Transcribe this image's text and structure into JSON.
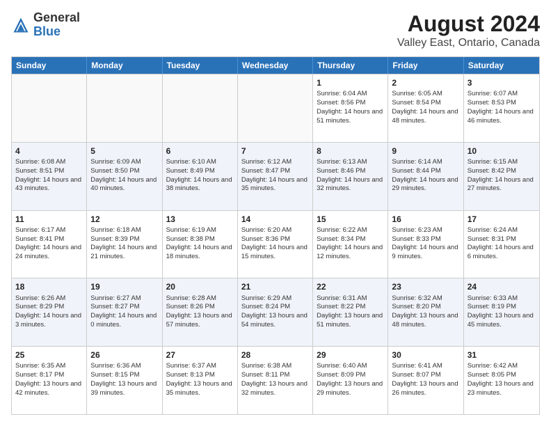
{
  "logo": {
    "general": "General",
    "blue": "Blue"
  },
  "header": {
    "monthYear": "August 2024",
    "location": "Valley East, Ontario, Canada"
  },
  "calendar": {
    "weekdays": [
      "Sunday",
      "Monday",
      "Tuesday",
      "Wednesday",
      "Thursday",
      "Friday",
      "Saturday"
    ],
    "rows": [
      [
        {
          "day": "",
          "info": ""
        },
        {
          "day": "",
          "info": ""
        },
        {
          "day": "",
          "info": ""
        },
        {
          "day": "",
          "info": ""
        },
        {
          "day": "1",
          "info": "Sunrise: 6:04 AM\nSunset: 8:56 PM\nDaylight: 14 hours and 51 minutes."
        },
        {
          "day": "2",
          "info": "Sunrise: 6:05 AM\nSunset: 8:54 PM\nDaylight: 14 hours and 48 minutes."
        },
        {
          "day": "3",
          "info": "Sunrise: 6:07 AM\nSunset: 8:53 PM\nDaylight: 14 hours and 46 minutes."
        }
      ],
      [
        {
          "day": "4",
          "info": "Sunrise: 6:08 AM\nSunset: 8:51 PM\nDaylight: 14 hours and 43 minutes."
        },
        {
          "day": "5",
          "info": "Sunrise: 6:09 AM\nSunset: 8:50 PM\nDaylight: 14 hours and 40 minutes."
        },
        {
          "day": "6",
          "info": "Sunrise: 6:10 AM\nSunset: 8:49 PM\nDaylight: 14 hours and 38 minutes."
        },
        {
          "day": "7",
          "info": "Sunrise: 6:12 AM\nSunset: 8:47 PM\nDaylight: 14 hours and 35 minutes."
        },
        {
          "day": "8",
          "info": "Sunrise: 6:13 AM\nSunset: 8:46 PM\nDaylight: 14 hours and 32 minutes."
        },
        {
          "day": "9",
          "info": "Sunrise: 6:14 AM\nSunset: 8:44 PM\nDaylight: 14 hours and 29 minutes."
        },
        {
          "day": "10",
          "info": "Sunrise: 6:15 AM\nSunset: 8:42 PM\nDaylight: 14 hours and 27 minutes."
        }
      ],
      [
        {
          "day": "11",
          "info": "Sunrise: 6:17 AM\nSunset: 8:41 PM\nDaylight: 14 hours and 24 minutes."
        },
        {
          "day": "12",
          "info": "Sunrise: 6:18 AM\nSunset: 8:39 PM\nDaylight: 14 hours and 21 minutes."
        },
        {
          "day": "13",
          "info": "Sunrise: 6:19 AM\nSunset: 8:38 PM\nDaylight: 14 hours and 18 minutes."
        },
        {
          "day": "14",
          "info": "Sunrise: 6:20 AM\nSunset: 8:36 PM\nDaylight: 14 hours and 15 minutes."
        },
        {
          "day": "15",
          "info": "Sunrise: 6:22 AM\nSunset: 8:34 PM\nDaylight: 14 hours and 12 minutes."
        },
        {
          "day": "16",
          "info": "Sunrise: 6:23 AM\nSunset: 8:33 PM\nDaylight: 14 hours and 9 minutes."
        },
        {
          "day": "17",
          "info": "Sunrise: 6:24 AM\nSunset: 8:31 PM\nDaylight: 14 hours and 6 minutes."
        }
      ],
      [
        {
          "day": "18",
          "info": "Sunrise: 6:26 AM\nSunset: 8:29 PM\nDaylight: 14 hours and 3 minutes."
        },
        {
          "day": "19",
          "info": "Sunrise: 6:27 AM\nSunset: 8:27 PM\nDaylight: 14 hours and 0 minutes."
        },
        {
          "day": "20",
          "info": "Sunrise: 6:28 AM\nSunset: 8:26 PM\nDaylight: 13 hours and 57 minutes."
        },
        {
          "day": "21",
          "info": "Sunrise: 6:29 AM\nSunset: 8:24 PM\nDaylight: 13 hours and 54 minutes."
        },
        {
          "day": "22",
          "info": "Sunrise: 6:31 AM\nSunset: 8:22 PM\nDaylight: 13 hours and 51 minutes."
        },
        {
          "day": "23",
          "info": "Sunrise: 6:32 AM\nSunset: 8:20 PM\nDaylight: 13 hours and 48 minutes."
        },
        {
          "day": "24",
          "info": "Sunrise: 6:33 AM\nSunset: 8:19 PM\nDaylight: 13 hours and 45 minutes."
        }
      ],
      [
        {
          "day": "25",
          "info": "Sunrise: 6:35 AM\nSunset: 8:17 PM\nDaylight: 13 hours and 42 minutes."
        },
        {
          "day": "26",
          "info": "Sunrise: 6:36 AM\nSunset: 8:15 PM\nDaylight: 13 hours and 39 minutes."
        },
        {
          "day": "27",
          "info": "Sunrise: 6:37 AM\nSunset: 8:13 PM\nDaylight: 13 hours and 35 minutes."
        },
        {
          "day": "28",
          "info": "Sunrise: 6:38 AM\nSunset: 8:11 PM\nDaylight: 13 hours and 32 minutes."
        },
        {
          "day": "29",
          "info": "Sunrise: 6:40 AM\nSunset: 8:09 PM\nDaylight: 13 hours and 29 minutes."
        },
        {
          "day": "30",
          "info": "Sunrise: 6:41 AM\nSunset: 8:07 PM\nDaylight: 13 hours and 26 minutes."
        },
        {
          "day": "31",
          "info": "Sunrise: 6:42 AM\nSunset: 8:05 PM\nDaylight: 13 hours and 23 minutes."
        }
      ]
    ],
    "altRows": [
      1,
      3
    ]
  }
}
